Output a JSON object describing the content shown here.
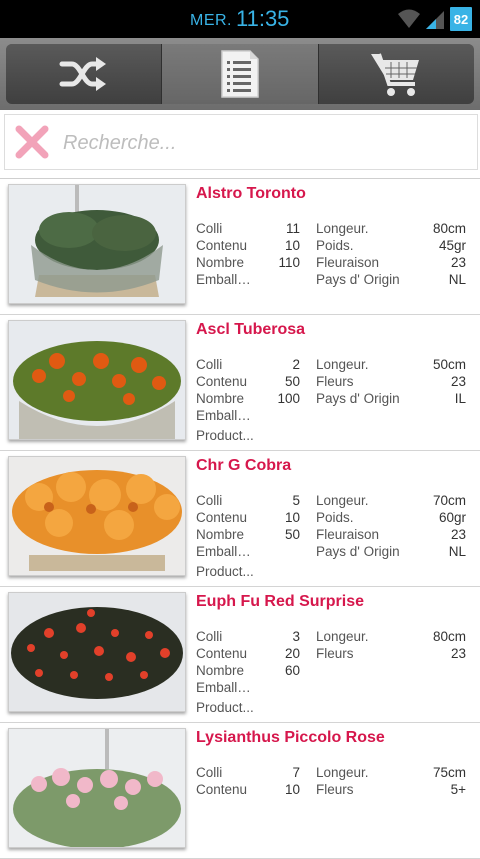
{
  "status": {
    "day": "MER.",
    "time": "11:35",
    "battery": "82"
  },
  "tabs": [
    {
      "name": "shuffle-icon"
    },
    {
      "name": "list-icon"
    },
    {
      "name": "cart-icon"
    }
  ],
  "colors": {
    "accent": "#d6174c",
    "status_blue": "#39b3e6"
  },
  "search": {
    "placeholder": "Recherche..."
  },
  "products": [
    {
      "name": "Alstro Toronto",
      "left": [
        [
          "Colli",
          "11"
        ],
        [
          "Contenu",
          "10"
        ],
        [
          "Nombre",
          "110"
        ],
        [
          "Emballage",
          ""
        ]
      ],
      "right": [
        [
          "Longeur.",
          "80cm"
        ],
        [
          "Poids.",
          "45gr"
        ],
        [
          "Fleuraison",
          "23"
        ],
        [
          "Pays d' Origin",
          "NL"
        ]
      ],
      "extra": ""
    },
    {
      "name": "Ascl Tuberosa",
      "left": [
        [
          "Colli",
          "2"
        ],
        [
          "Contenu",
          "50"
        ],
        [
          "Nombre",
          "100"
        ],
        [
          "Emballage",
          ""
        ]
      ],
      "right": [
        [
          "Longeur.",
          "50cm"
        ],
        [
          "Fleurs",
          "23"
        ],
        [
          "Pays d' Origin",
          "IL"
        ]
      ],
      "extra": "Product..."
    },
    {
      "name": "Chr G Cobra",
      "left": [
        [
          "Colli",
          "5"
        ],
        [
          "Contenu",
          "10"
        ],
        [
          "Nombre",
          "50"
        ],
        [
          "Emballage",
          ""
        ]
      ],
      "right": [
        [
          "Longeur.",
          "70cm"
        ],
        [
          "Poids.",
          "60gr"
        ],
        [
          "Fleuraison",
          "23"
        ],
        [
          "Pays d' Origin",
          "NL"
        ]
      ],
      "extra": "Product..."
    },
    {
      "name": "Euph Fu Red Surprise",
      "left": [
        [
          "Colli",
          "3"
        ],
        [
          "Contenu",
          "20"
        ],
        [
          "Nombre",
          "60"
        ],
        [
          "Emballage",
          ""
        ]
      ],
      "right": [
        [
          "Longeur.",
          "80cm"
        ],
        [
          "Fleurs",
          "23"
        ]
      ],
      "extra": "Product..."
    },
    {
      "name": "Lysianthus Piccolo Rose",
      "left": [
        [
          "Colli",
          "7"
        ],
        [
          "Contenu",
          "10"
        ]
      ],
      "right": [
        [
          "Longeur.",
          "75cm"
        ],
        [
          "Fleurs",
          "5+"
        ]
      ],
      "extra": ""
    }
  ]
}
